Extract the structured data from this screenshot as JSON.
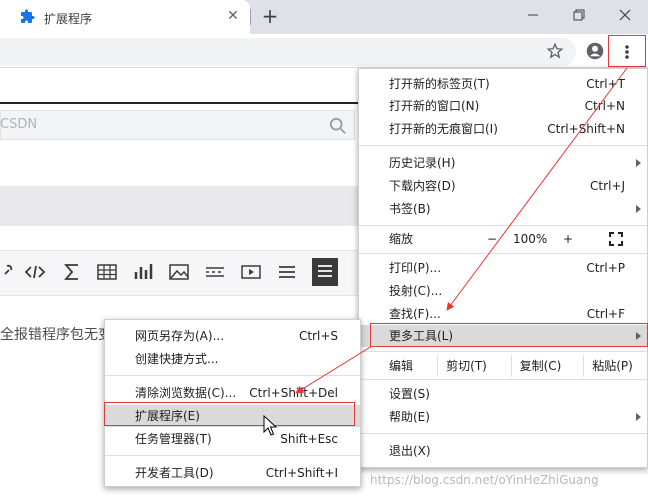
{
  "tab": {
    "title": "扩展程序",
    "close": "✕",
    "new_tab": "+"
  },
  "window": {
    "minimize": "—",
    "maximize": "❐",
    "close": "✕"
  },
  "page": {
    "search_placeholder": "CSDN",
    "body_text": "全报错程序包无变"
  },
  "main_menu": {
    "items": [
      {
        "label": "打开新的标签页(T)",
        "shortcut": "Ctrl+T"
      },
      {
        "label": "打开新的窗口(N)",
        "shortcut": "Ctrl+N"
      },
      {
        "label": "打开新的无痕窗口(I)",
        "shortcut": "Ctrl+Shift+N"
      },
      {
        "label": "历史记录(H)",
        "shortcut": ""
      },
      {
        "label": "下载内容(D)",
        "shortcut": "Ctrl+J"
      },
      {
        "label": "书签(B)",
        "shortcut": ""
      },
      {
        "label": "打印(P)...",
        "shortcut": "Ctrl+P"
      },
      {
        "label": "投射(C)...",
        "shortcut": ""
      },
      {
        "label": "查找(F)...",
        "shortcut": "Ctrl+F"
      },
      {
        "label": "更多工具(L)",
        "shortcut": ""
      },
      {
        "label": "设置(S)",
        "shortcut": ""
      },
      {
        "label": "帮助(E)",
        "shortcut": ""
      },
      {
        "label": "退出(X)",
        "shortcut": ""
      }
    ],
    "zoom": {
      "label": "缩放",
      "minus": "−",
      "value": "100%",
      "plus": "+"
    },
    "edit": {
      "label": "编辑",
      "cut": "剪切(T)",
      "copy": "复制(C)",
      "paste": "粘贴(P)"
    }
  },
  "sub_menu": {
    "items": [
      {
        "label": "网页另存为(A)...",
        "shortcut": "Ctrl+S"
      },
      {
        "label": "创建快捷方式...",
        "shortcut": ""
      },
      {
        "label": "清除浏览数据(C)...",
        "shortcut": "Ctrl+Shift+Del"
      },
      {
        "label": "扩展程序(E)",
        "shortcut": ""
      },
      {
        "label": "任务管理器(T)",
        "shortcut": "Shift+Esc"
      },
      {
        "label": "开发者工具(D)",
        "shortcut": "Ctrl+Shift+I"
      }
    ]
  },
  "watermark": "https://blog.csdn.net/oYinHeZhiGuang",
  "colors": {
    "highlight_border": "#e53935",
    "chrome_bg": "#dee1e6",
    "accent": "#1a73e8"
  }
}
